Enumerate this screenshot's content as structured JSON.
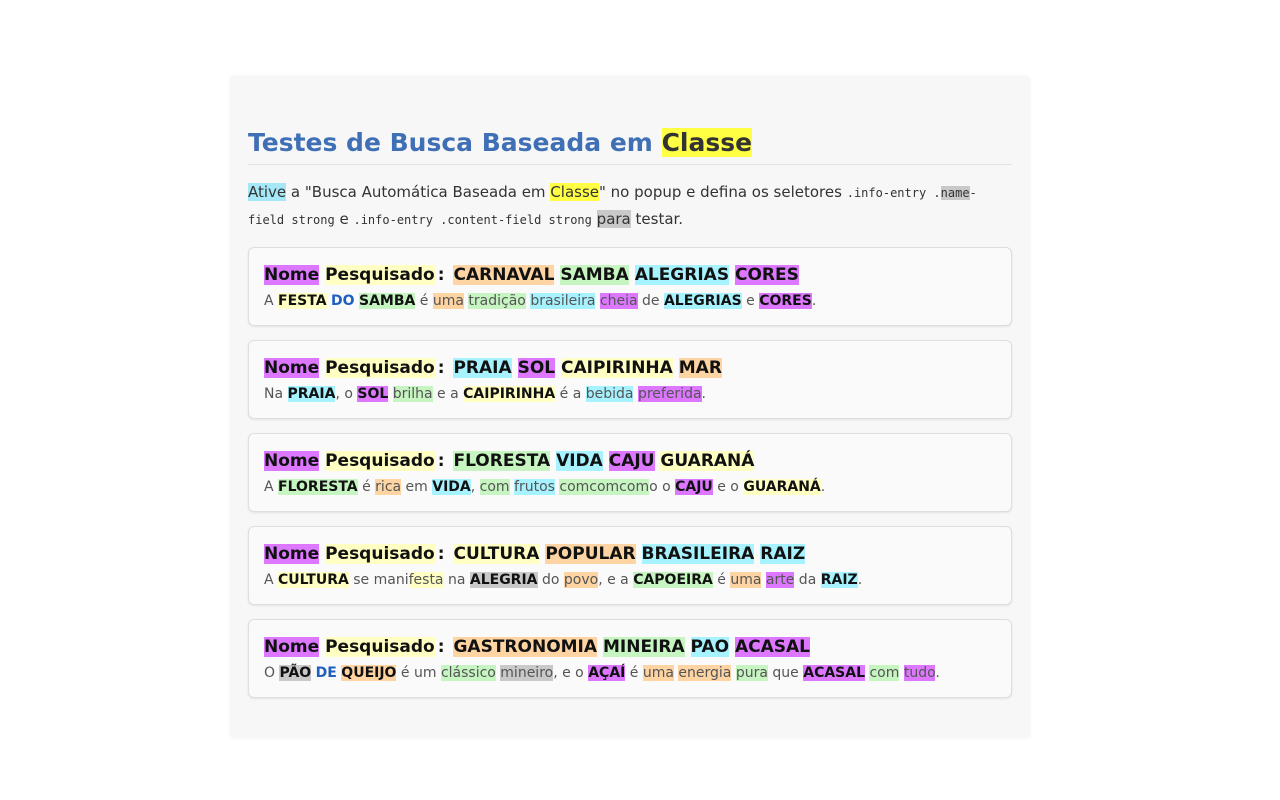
{
  "page": {
    "title_prefix": "Testes de Busca Baseada em ",
    "title_highlight": "Classe",
    "intro": {
      "w1": "Ative",
      "t1": " a \"Busca Automática Baseada em ",
      "w2": "Classe",
      "t2": "\" no popup e defina os seletores ",
      "code1a": ".info-entry .",
      "code1b": "name",
      "code1c": "-field strong",
      "t3": " e ",
      "code2": ".info-entry .content-field strong",
      "t4": " ",
      "w3": "para",
      "t5": " testar."
    }
  },
  "colors": {
    "yellow": "#ffff44",
    "light_yellow": "#ffffc4",
    "cyan": "#a6f2ff",
    "green": "#c6f5c1",
    "peach": "#ffd4a3",
    "purple": "#dd77ff",
    "gray": "#c9c9c9",
    "title_blue": "#3f6fb5",
    "link_blue": "#1e5fbf"
  },
  "cards": [
    {
      "name_label": "Nome",
      "searched_label": "Pesquisado",
      "colon": ":",
      "terms": [
        "CARNAVAL",
        "SAMBA",
        "ALEGRIAS",
        "CORES"
      ],
      "content": {
        "a": "A ",
        "b": "FESTA",
        "c": " ",
        "d": "DO",
        "e": " ",
        "f": "SAMBA",
        "g": " é ",
        "h": "uma",
        "i": " ",
        "j": "tradição",
        "k": " ",
        "l": "brasileira",
        "m": " ",
        "n": "cheia",
        "o": " de ",
        "p": "ALEGRIAS",
        "q": " e ",
        "r": "CORES",
        "s": "."
      }
    },
    {
      "name_label": "Nome",
      "searched_label": "Pesquisado",
      "colon": ":",
      "terms": [
        "PRAIA",
        "SOL",
        "CAIPIRINHA",
        "MAR"
      ],
      "content": {
        "a": "Na ",
        "b": "PRAIA",
        "c": ", o ",
        "d": "SOL",
        "e": " ",
        "f": "brilha",
        "g": " e a ",
        "h": "CAIPIRINHA",
        "i": " é a ",
        "j": "bebida",
        "k": " ",
        "l": "preferida",
        "m": "."
      }
    },
    {
      "name_label": "Nome",
      "searched_label": "Pesquisado",
      "colon": ":",
      "terms": [
        "FLORESTA",
        "VIDA",
        "CAJU",
        "GUARANÁ"
      ],
      "content": {
        "a": "A ",
        "b": "FLORESTA",
        "c": " é ",
        "d": "rica",
        "e": " em ",
        "f": "VIDA",
        "g": ", ",
        "h": "com",
        "i": " ",
        "j": "frutos",
        "k": " ",
        "l": "comcomcom",
        "m": "o o ",
        "n": "CAJU",
        "o": " e o ",
        "p": "GUARANÁ",
        "q": "."
      }
    },
    {
      "name_label": "Nome",
      "searched_label": "Pesquisado",
      "colon": ":",
      "terms": [
        "CULTURA",
        "POPULAR",
        "BRASILEIRA",
        "RAIZ"
      ],
      "content": {
        "a": "A ",
        "b": "CULTURA",
        "c": " se mani",
        "d": "festa",
        "e": " na ",
        "f": "ALEGRIA",
        "g": " do ",
        "h": "povo",
        "i": ", e a ",
        "j": "CAPOEIRA",
        "k": " é ",
        "l": "uma",
        "m": " ",
        "n": "arte",
        "o": " da ",
        "p": "RAIZ",
        "q": "."
      }
    },
    {
      "name_label": "Nome",
      "searched_label": "Pesquisado",
      "colon": ":",
      "terms": [
        "GASTRONOMIA",
        "MINEIRA",
        "PAO",
        "ACASAL"
      ],
      "content": {
        "a": "O ",
        "b": "PÃO",
        "c": " ",
        "d": "DE",
        "e": " ",
        "f": "QUEIJO",
        "g": " é um ",
        "h": "clássico",
        "i": " ",
        "j": "mineiro",
        "k": ", e o ",
        "l": "AÇAÍ",
        "m": " é ",
        "n": "uma",
        "o": " ",
        "p": "energia",
        "q": " ",
        "r": "pura",
        "s": " que ",
        "t": "ACASAL",
        "u": " ",
        "v": "com",
        "w": " ",
        "x": "tudo",
        "y": "."
      }
    }
  ]
}
